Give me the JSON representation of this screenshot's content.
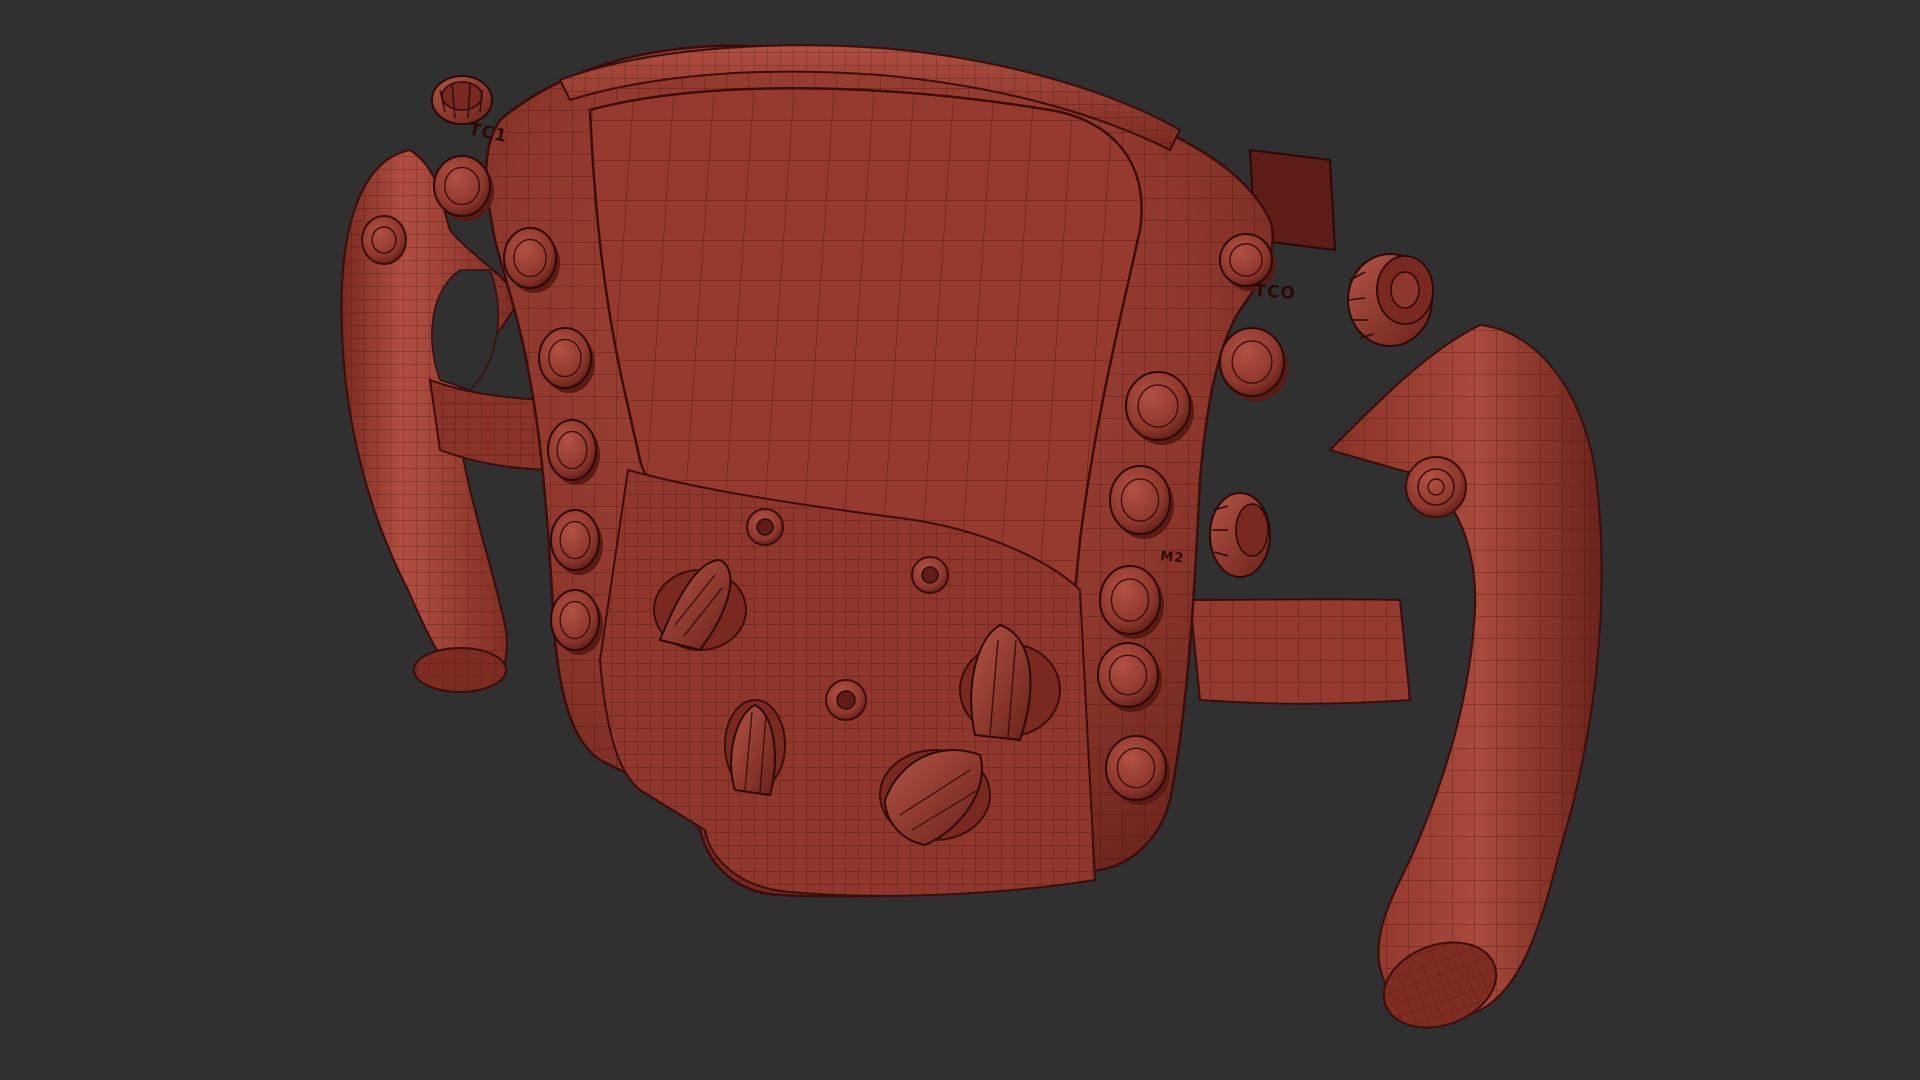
{
  "colors": {
    "background": "#303030",
    "clay": "#933a2f",
    "clay_light": "#a8493b",
    "clay_dark": "#5e1d16",
    "wire": "#3a0f0b"
  },
  "engraved_labels": {
    "left_rotary": "TC1",
    "right_rotary": "TCO",
    "right_button": "M2"
  }
}
